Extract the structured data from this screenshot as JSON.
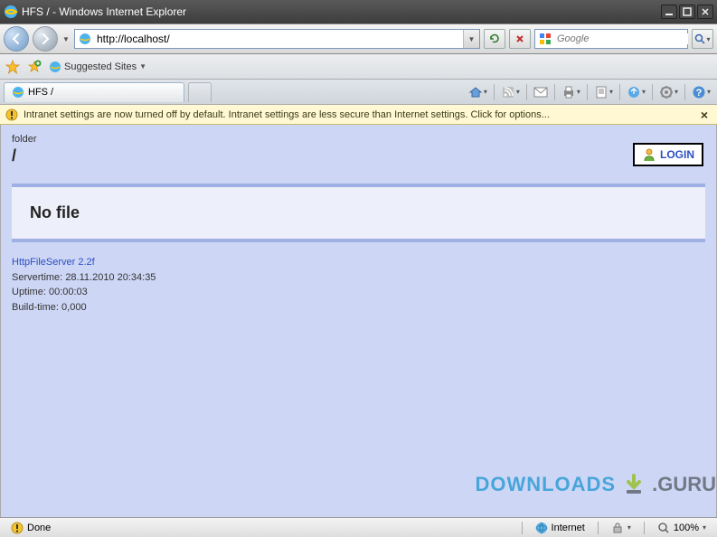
{
  "window": {
    "title": "HFS / - Windows Internet Explorer"
  },
  "nav": {
    "url": "http://localhost/"
  },
  "search": {
    "placeholder": "Google"
  },
  "favorites": {
    "suggested": "Suggested Sites"
  },
  "tab": {
    "label": "HFS /"
  },
  "infobar": {
    "message": "Intranet settings are now turned off by default. Intranet settings are less secure than Internet settings. Click for options..."
  },
  "page": {
    "folder_label": "folder",
    "path": "/",
    "login_label": "LOGIN",
    "nofile": "No file",
    "server_link": "HttpFileServer 2.2f",
    "servertime_label": "Servertime:",
    "servertime": "28.11.2010 20:34:35",
    "uptime_label": "Uptime:",
    "uptime": "00:00:03",
    "buildtime_label": "Build-time:",
    "buildtime": "0,000"
  },
  "status": {
    "done": "Done",
    "zone": "Internet",
    "zoom": "100%"
  },
  "watermark": {
    "t1": "DOWNLOADS",
    "t2": ".GURU"
  }
}
